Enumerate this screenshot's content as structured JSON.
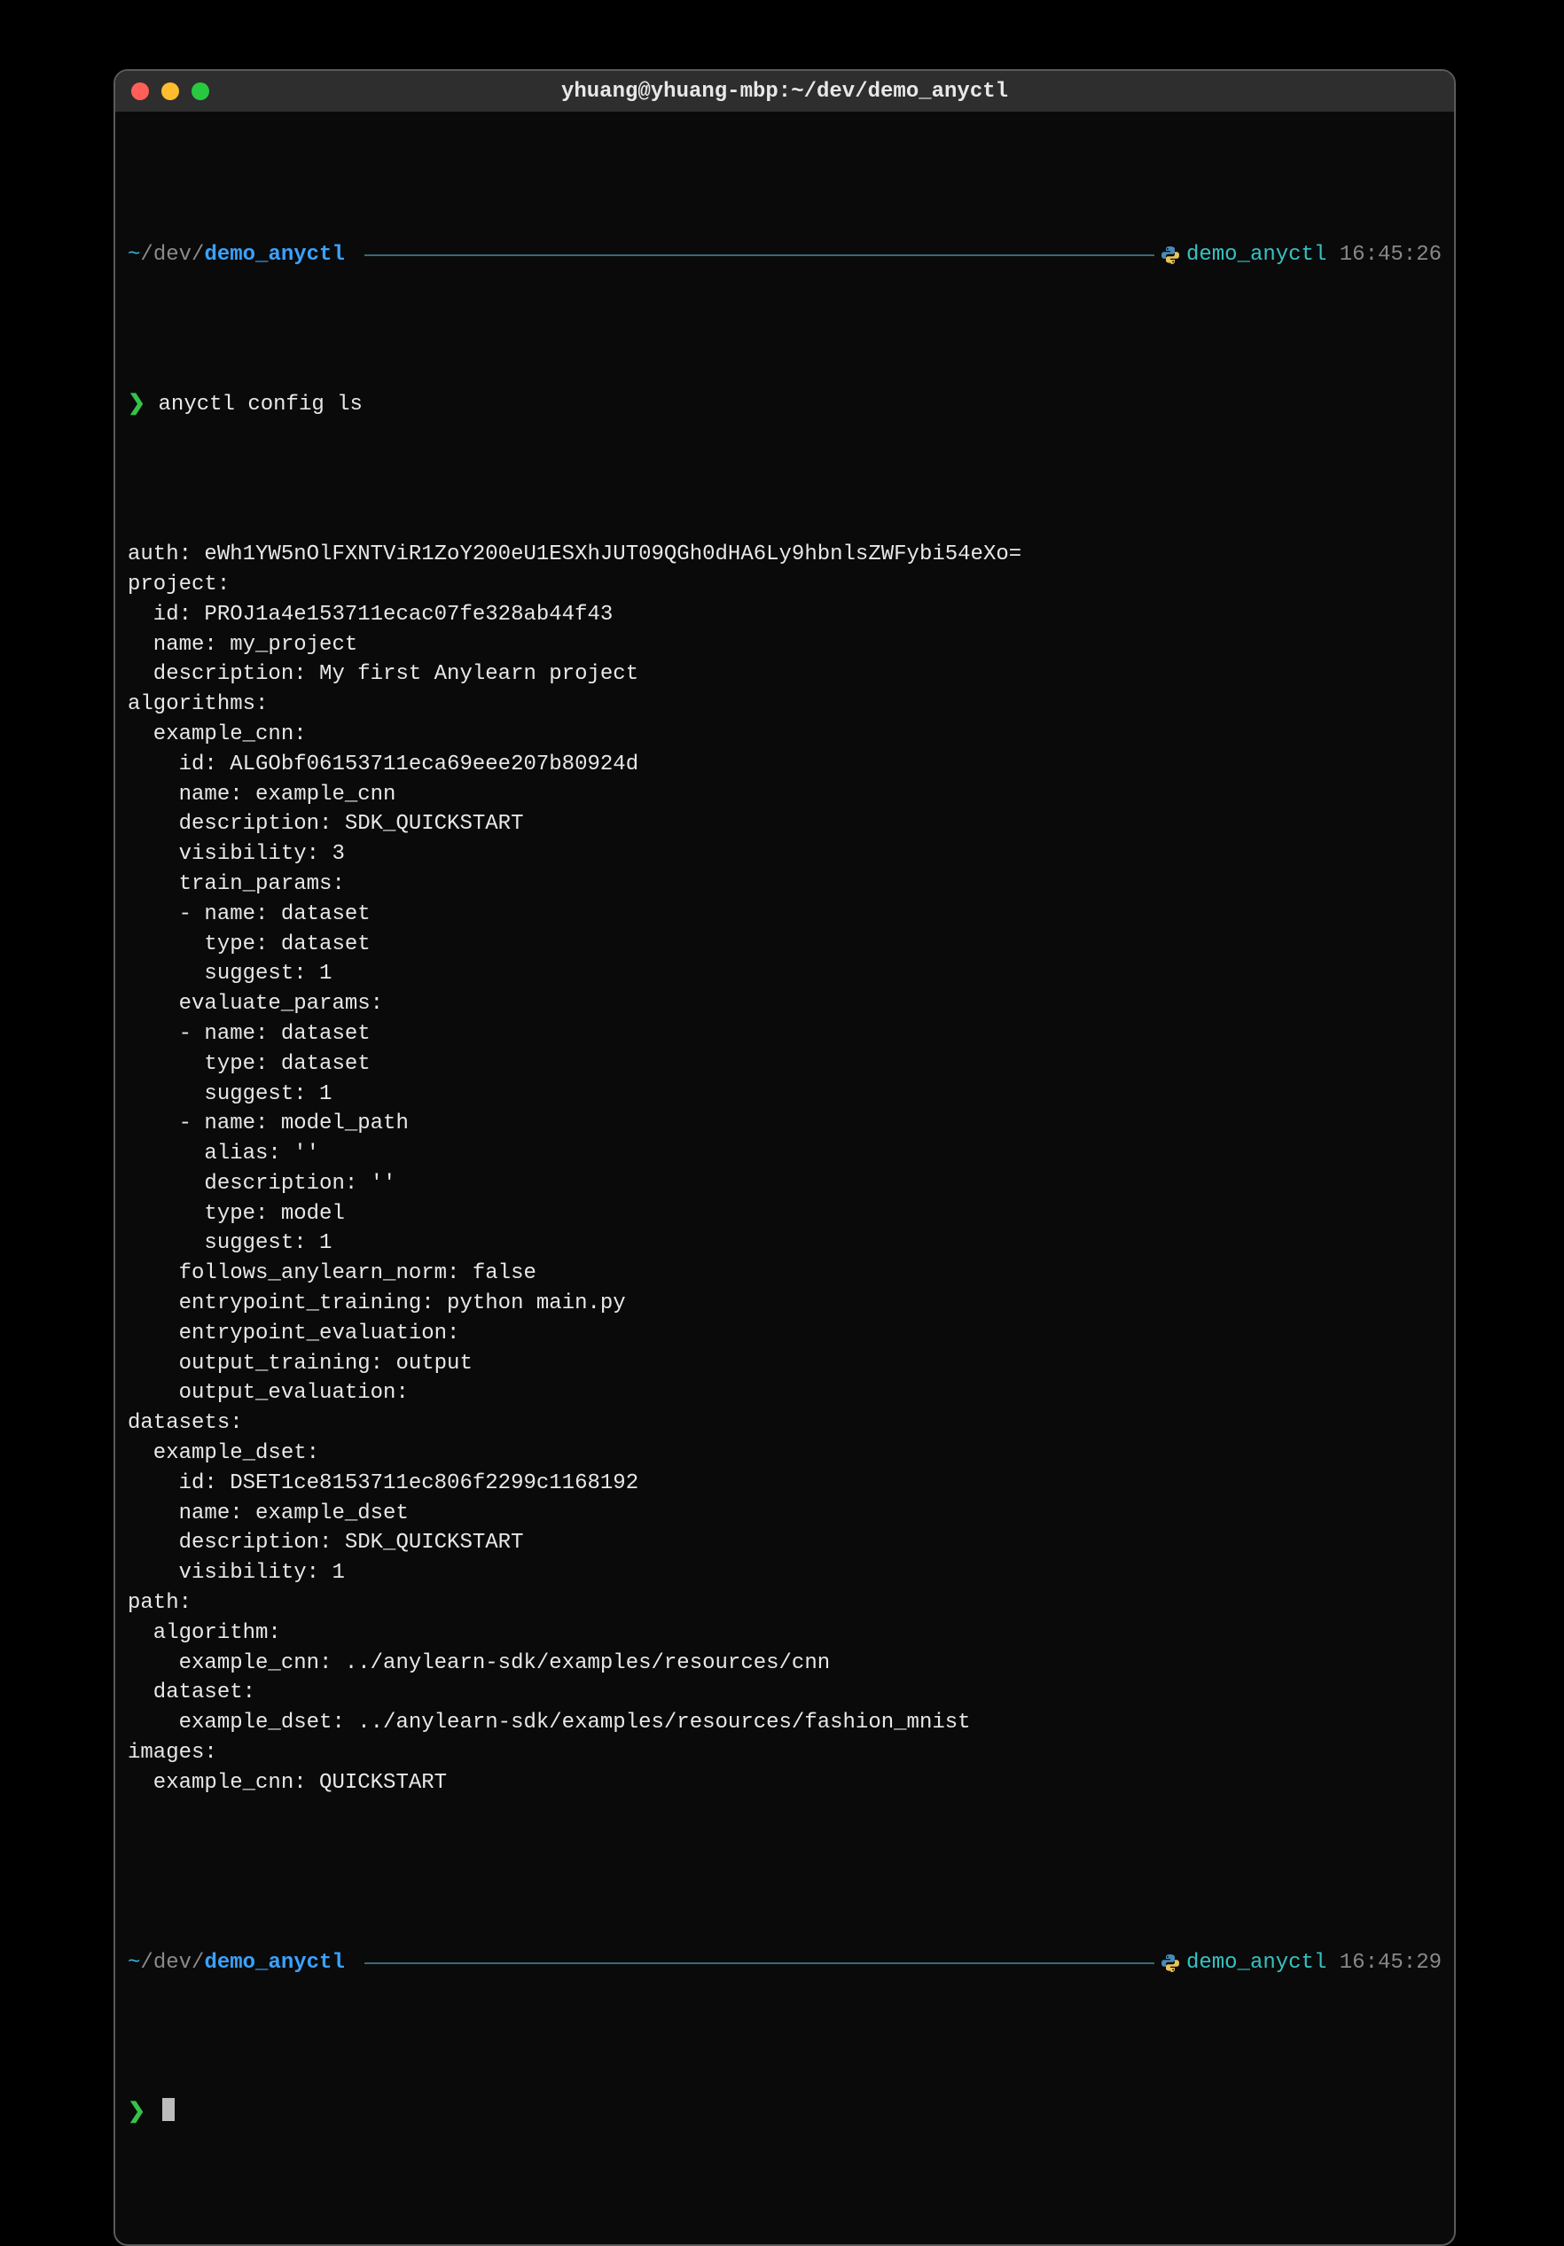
{
  "titlebar": {
    "title": "yhuang@yhuang-mbp:~/dev/demo_anyctl"
  },
  "session1": {
    "path_tilde": "~",
    "path_sep1": "/",
    "path_dev": "dev",
    "path_sep2": "/",
    "path_dir": "demo_anyctl",
    "env": "demo_anyctl",
    "time": "16:45:26",
    "prompt_arrow": "❯",
    "command": "anyctl config ls"
  },
  "output": {
    "lines": [
      "auth: eWh1YW5nOlFXNTViR1ZoY200eU1ESXhJUT09QGh0dHA6Ly9hbnlsZWFybi54eXo=",
      "project:",
      "  id: PROJ1a4e153711ecac07fe328ab44f43",
      "  name: my_project",
      "  description: My first Anylearn project",
      "algorithms:",
      "  example_cnn:",
      "    id: ALGObf06153711eca69eee207b80924d",
      "    name: example_cnn",
      "    description: SDK_QUICKSTART",
      "    visibility: 3",
      "    train_params:",
      "    - name: dataset",
      "      type: dataset",
      "      suggest: 1",
      "    evaluate_params:",
      "    - name: dataset",
      "      type: dataset",
      "      suggest: 1",
      "    - name: model_path",
      "      alias: ''",
      "      description: ''",
      "      type: model",
      "      suggest: 1",
      "    follows_anylearn_norm: false",
      "    entrypoint_training: python main.py",
      "    entrypoint_evaluation:",
      "    output_training: output",
      "    output_evaluation:",
      "datasets:",
      "  example_dset:",
      "    id: DSET1ce8153711ec806f2299c1168192",
      "    name: example_dset",
      "    description: SDK_QUICKSTART",
      "    visibility: 1",
      "path:",
      "  algorithm:",
      "    example_cnn: ../anylearn-sdk/examples/resources/cnn",
      "  dataset:",
      "    example_dset: ../anylearn-sdk/examples/resources/fashion_mnist",
      "images:",
      "  example_cnn: QUICKSTART",
      ""
    ]
  },
  "session2": {
    "path_tilde": "~",
    "path_sep1": "/",
    "path_dev": "dev",
    "path_sep2": "/",
    "path_dir": "demo_anyctl",
    "env": "demo_anyctl",
    "time": "16:45:29",
    "prompt_arrow": "❯",
    "command": ""
  }
}
